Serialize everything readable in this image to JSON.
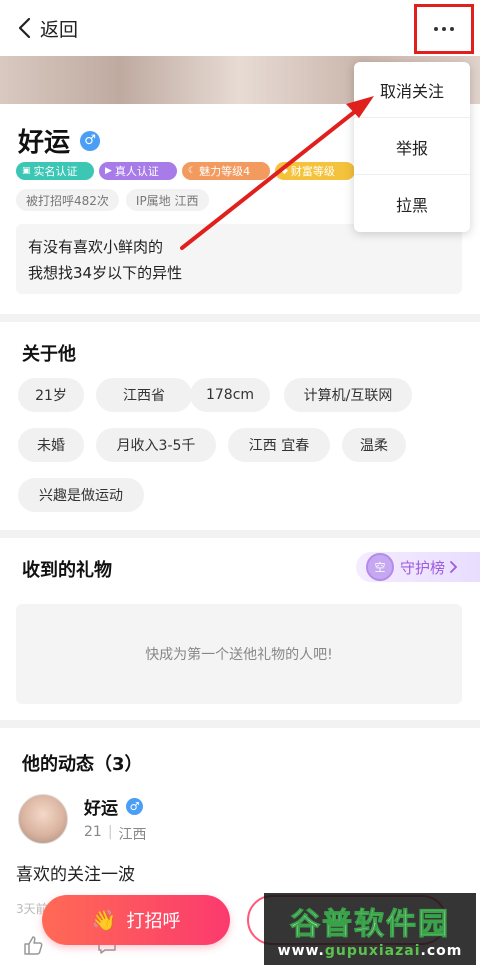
{
  "header": {
    "back_label": "返回",
    "more_icon": "more-dots-icon"
  },
  "menu": {
    "items": [
      "取消关注",
      "举报",
      "拉黑"
    ]
  },
  "profile": {
    "name": "好运",
    "gender_symbol": "♂",
    "badges": [
      "实名认证",
      "真人认证",
      "魅力等级4",
      "财富等级"
    ],
    "chips": [
      "被打招呼482次",
      "IP属地 江西"
    ],
    "bio_lines": [
      "有没有喜欢小鲜肉的",
      "我想找34岁以下的异性"
    ]
  },
  "about": {
    "title": "关于他",
    "tags": [
      "21岁",
      "江西省",
      "178cm",
      "计算机/互联网",
      "未婚",
      "月收入3-5千",
      "江西 宜春",
      "温柔",
      "兴趣是做运动"
    ]
  },
  "gifts": {
    "title": "收到的礼物",
    "guard_label": "守护榜",
    "guard_avatar_text": "空",
    "empty_text": "快成为第一个送他礼物的人吧!"
  },
  "feed": {
    "title": "他的动态（3）",
    "author": "好运",
    "age": "21",
    "location": "江西",
    "text": "喜欢的关注一波",
    "time": "3天前"
  },
  "actions": {
    "greet_label": "打招呼",
    "greet_icon": "waving-hand-icon"
  },
  "watermark": {
    "brand": "谷普软件园",
    "url_prefix": "www.",
    "url_main": "gupuxiazai",
    "url_suffix": ".com"
  },
  "colors": {
    "annotation_red": "#e0201c",
    "greet_gradient_start": "#ff6a55",
    "greet_gradient_end": "#fb3a6e",
    "gender_blue": "#4a9ef5",
    "guard_purple": "#9b5ce0"
  }
}
